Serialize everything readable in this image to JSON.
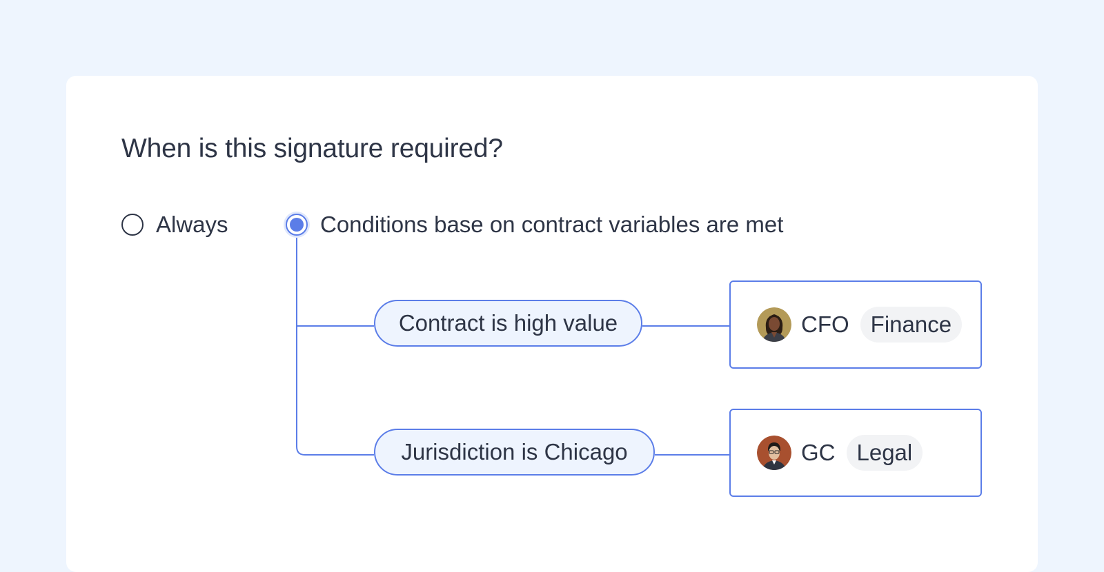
{
  "question": {
    "title": "When is this signature required?"
  },
  "options": [
    {
      "label": "Always",
      "selected": false
    },
    {
      "label": "Conditions base on contract variables are met",
      "selected": true
    }
  ],
  "conditions": [
    {
      "label": "Contract is high value",
      "approver": {
        "role": "CFO",
        "department": "Finance",
        "avatar": "person-avatar-woman"
      }
    },
    {
      "label": "Jurisdiction is Chicago",
      "approver": {
        "role": "GC",
        "department": "Legal",
        "avatar": "person-avatar-man"
      }
    }
  ],
  "colors": {
    "background": "#eef5fe",
    "accent": "#5b7de8",
    "condition_fill": "#eef4fe",
    "text": "#2e3546",
    "tag_fill": "#f2f3f5"
  }
}
